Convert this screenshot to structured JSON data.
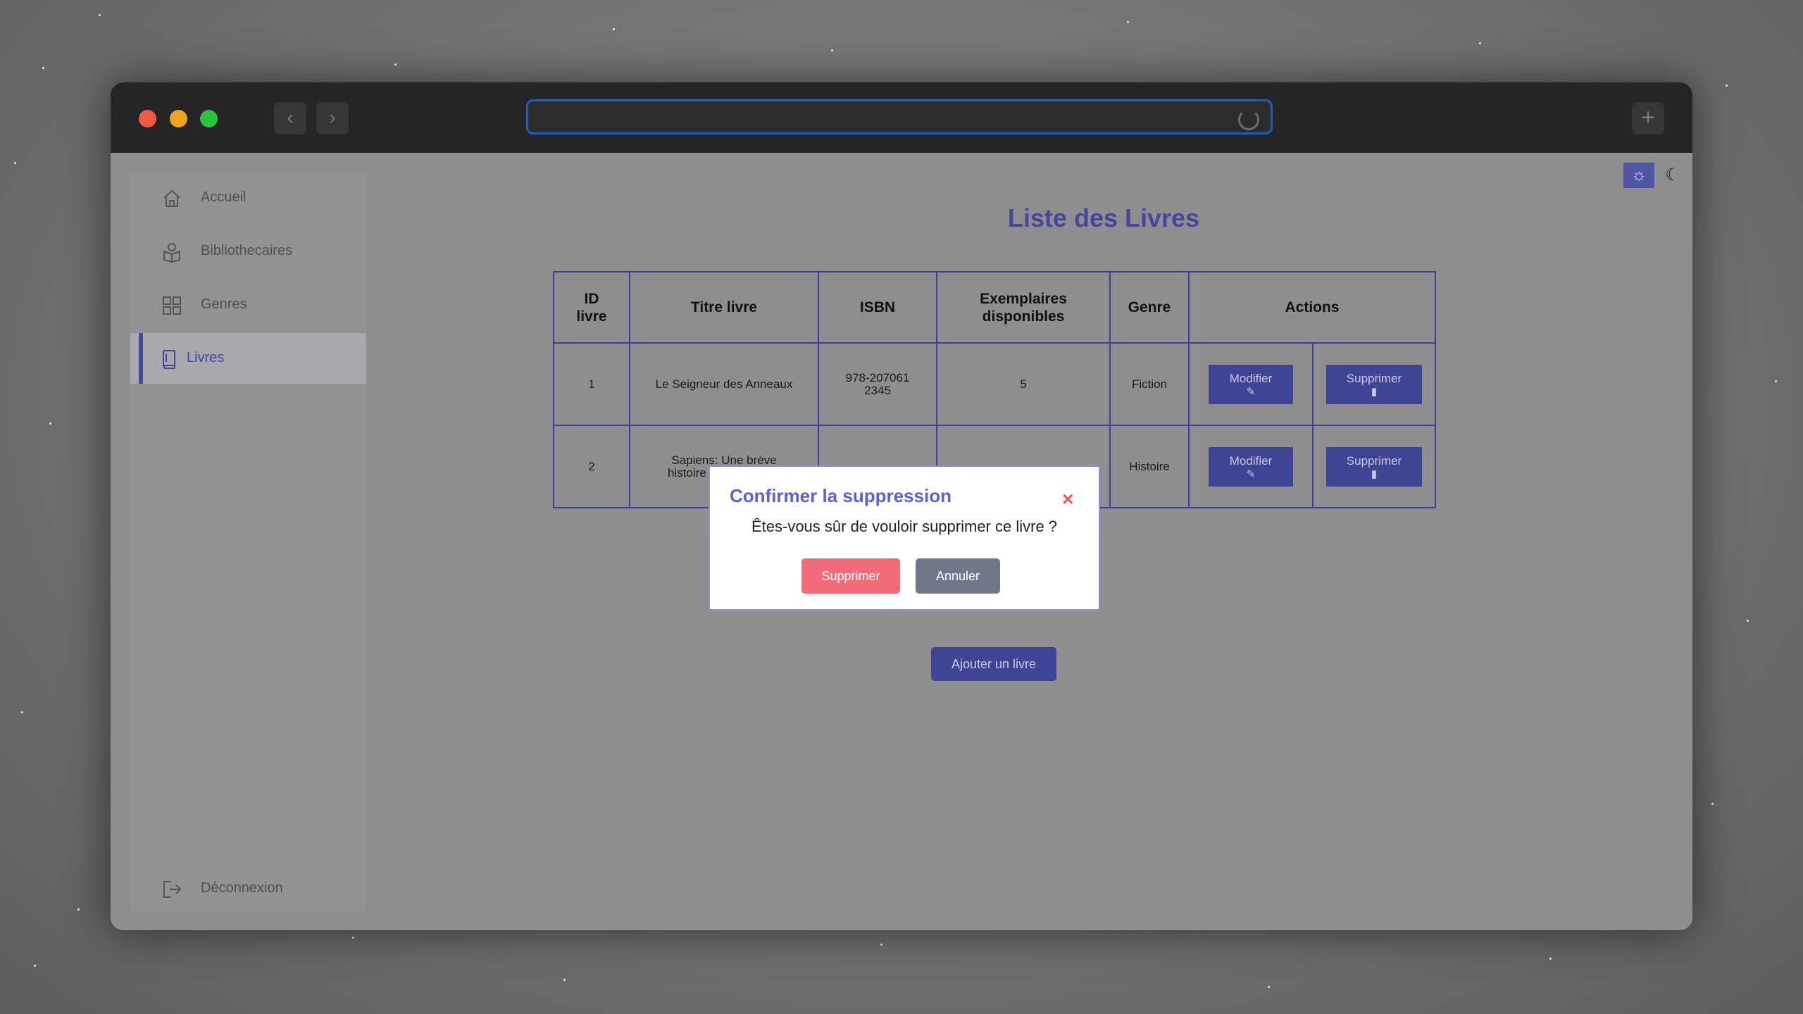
{
  "browser": {
    "url": "",
    "back_icon": "‹",
    "forward_icon": "›",
    "new_tab_icon": "+"
  },
  "sidebar": {
    "items": [
      {
        "label": "Accueil",
        "icon": "home-icon"
      },
      {
        "label": "Bibliothecaires",
        "icon": "librarian-icon"
      },
      {
        "label": "Genres",
        "icon": "grid-icon"
      },
      {
        "label": "Livres",
        "icon": "book-icon",
        "active": true
      }
    ],
    "logout": {
      "label": "Déconnexion",
      "icon": "logout-icon"
    }
  },
  "theme": {
    "light_icon": "☼",
    "dark_icon": "☾"
  },
  "page": {
    "title": "Liste des Livres"
  },
  "table": {
    "headers": {
      "id": "ID livre",
      "title": "Titre livre",
      "isbn": "ISBN",
      "copies": "Exemplaires disponibles",
      "genre": "Genre",
      "actions": "Actions"
    },
    "rows": [
      {
        "id": "1",
        "title": "Le Seigneur des Anneaux",
        "isbn": "978-2070612345",
        "copies": "5",
        "genre": "Fiction",
        "edit": "Modifier",
        "delete": "Supprimer"
      },
      {
        "id": "2",
        "title": "Sapiens: Une brève histoire de l'humanité",
        "isbn": "",
        "copies": "",
        "genre": "Histoire",
        "edit": "Modifier",
        "delete": "Supprimer"
      }
    ]
  },
  "add_button": "Ajouter un livre",
  "modal": {
    "title": "Confirmer la suppression",
    "close_icon": "×",
    "message": "Êtes-vous sûr de vouloir supprimer ce livre ?",
    "confirm": "Supprimer",
    "cancel": "Annuler"
  },
  "colors": {
    "accent": "#3f4495",
    "title": "#45469d",
    "danger": "#f46b78",
    "cancel": "#6f7788"
  }
}
